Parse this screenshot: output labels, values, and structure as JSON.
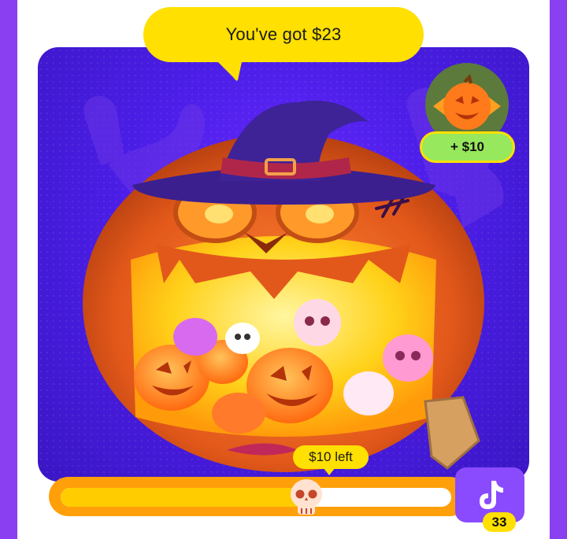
{
  "header": {
    "reward_message": "You've got $23"
  },
  "reward": {
    "badge_label": "+ $10",
    "icon": "jack-o-lantern-candy-icon"
  },
  "progress": {
    "remaining_label": "$10 left",
    "fraction": 0.63,
    "handle_icon": "skull-icon"
  },
  "app_button": {
    "icon": "tiktok-icon",
    "count": "33"
  },
  "colors": {
    "accent_yellow": "#ffe000",
    "progress_orange": "#ff9f0a",
    "scene_purple": "#4c1ee8",
    "badge_green": "#97e85c",
    "app_purple": "#8a4bff"
  }
}
